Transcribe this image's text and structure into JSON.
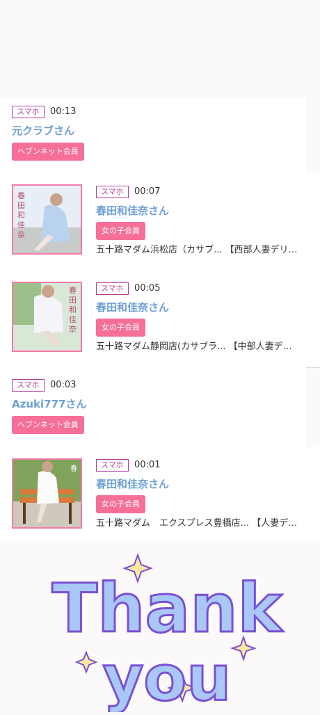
{
  "entries": [
    {
      "device": "スマホ",
      "time": "00:13",
      "name": "元クラブさん",
      "member": "ヘブンネット会員",
      "shop": ""
    },
    {
      "device": "スマホ",
      "time": "00:07",
      "name": "春田和佳奈さん",
      "member": "女の子会員",
      "shop": "五十路マダム浜松店（カサブ... 【西部人妻デリヘル..."
    },
    {
      "device": "スマホ",
      "time": "00:05",
      "name": "春田和佳奈さん",
      "member": "女の子会員",
      "shop": "五十路マダム静岡店(カサブラ... 【中部人妻デリヘ..."
    },
    {
      "device": "スマホ",
      "time": "00:03",
      "name": "Azuki777さん",
      "member": "ヘブンネット会員",
      "shop": ""
    },
    {
      "device": "スマホ",
      "time": "00:01",
      "name": "春田和佳奈さん",
      "member": "女の子会員",
      "shop": "五十路マダム　エクスプレス豊橋店... 【人妻デリ..."
    }
  ],
  "thanks": {
    "line1": "Thank",
    "line2": "you"
  },
  "colors": {
    "accent": "#f56f96",
    "name": "#6d9fd6",
    "badge": "#b43c9b",
    "thanks_fill": "#a9c8f7",
    "thanks_stroke": "#7a4fd4",
    "sparkle": "#fbe9a0"
  }
}
